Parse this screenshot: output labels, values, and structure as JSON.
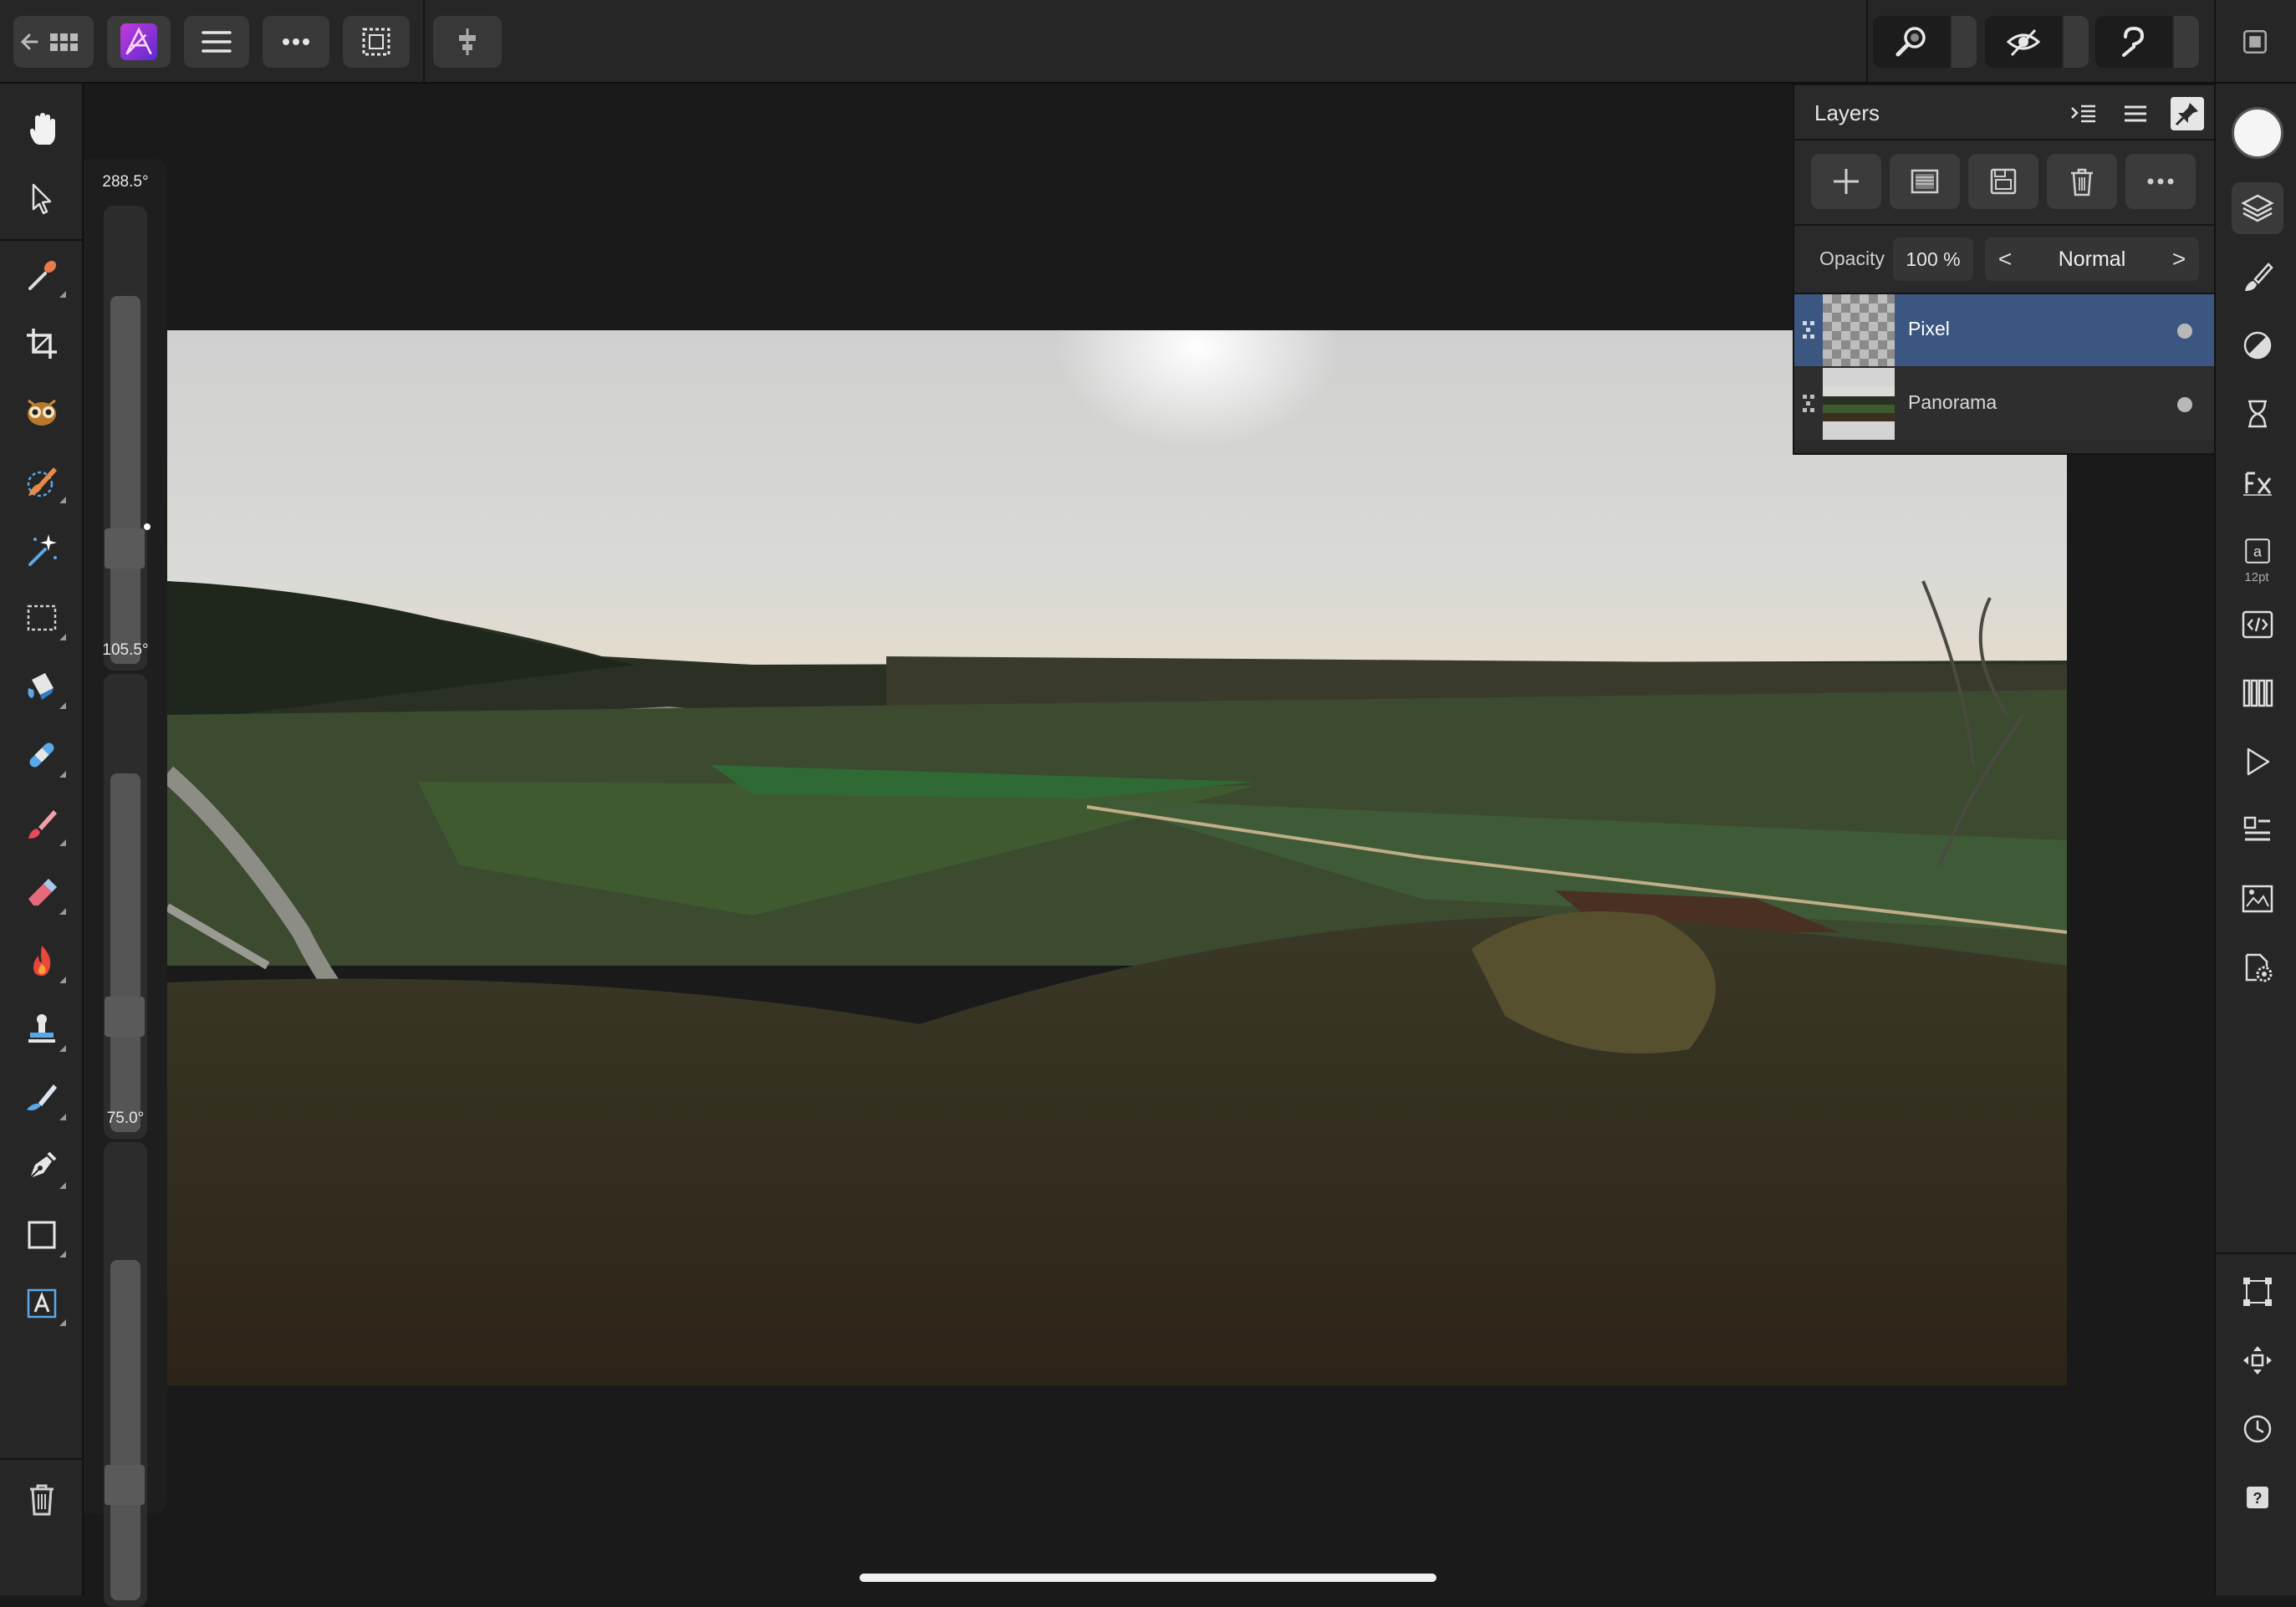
{
  "app": {
    "name": "Affinity Photo",
    "accent_color": "#8c3fd6",
    "selection_color": "#3b5680"
  },
  "toolbar": {
    "back_icon": "back-grid-icon",
    "buttons": [
      "app-logo-icon",
      "menu-icon",
      "more-icon",
      "selection-marquee-icon",
      "align-icon"
    ],
    "right_buttons": [
      "zoom-icon",
      "hide-ui-icon",
      "assistant-icon",
      "window-icon"
    ]
  },
  "tools": [
    "hand-icon",
    "move-pointer-icon",
    "color-picker-icon",
    "crop-icon",
    "red-eye-icon",
    "selection-brush-icon",
    "magic-wand-icon",
    "marquee-icon",
    "flood-fill-icon",
    "healing-icon",
    "paint-brush-icon",
    "eraser-icon",
    "burn-icon",
    "clone-stamp-icon",
    "smudge-icon",
    "pen-icon",
    "rectangle-icon",
    "text-frame-icon",
    "trash-icon"
  ],
  "sliders": [
    {
      "label": "288.5°",
      "level": 0.82
    },
    {
      "label": "105.5°",
      "level": 0.8
    },
    {
      "label": "75.0°",
      "level": 0.76
    }
  ],
  "layers_panel": {
    "title": "Layers",
    "opacity_label": "Opacity",
    "opacity_value": "100 %",
    "blend_mode": "Normal",
    "blend_prev": "<",
    "blend_next": ">",
    "layers": [
      {
        "name": "Pixel",
        "selected": true,
        "visible": true
      },
      {
        "name": "Panorama",
        "selected": false,
        "visible": true
      }
    ]
  },
  "studio": {
    "primary_color": "#f5f5f5",
    "font_size_hint": "12pt",
    "text_icon_glyph": "a",
    "icons": [
      "layers-icon",
      "brushes-icon",
      "adjustments-icon",
      "history-icon",
      "fx-icon",
      "text-styles-icon",
      "code-icon",
      "channels-icon",
      "play-icon",
      "swatches-icon",
      "navigator-icon",
      "settings-icon",
      "transform-icon",
      "move-icon",
      "history-clock-icon",
      "help-icon"
    ],
    "help_glyph": "?"
  }
}
